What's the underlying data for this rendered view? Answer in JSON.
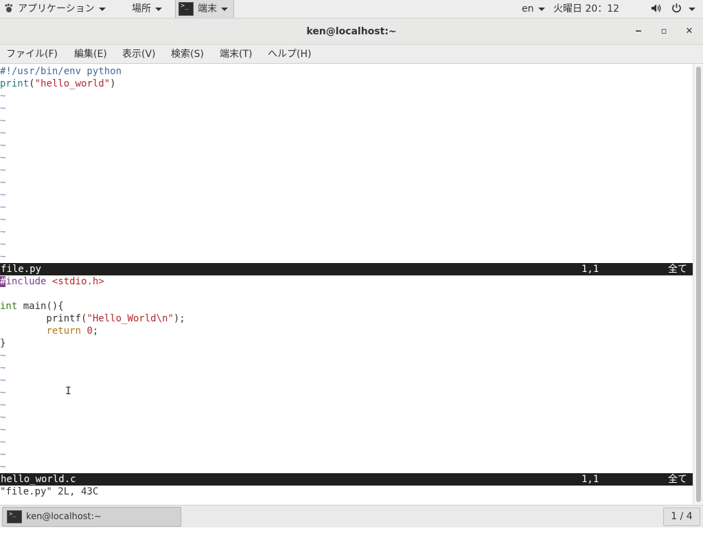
{
  "topbar": {
    "applications": "アプリケーション",
    "places": "場所",
    "active_app": "端末",
    "active_app_icon_text": ">_",
    "language": "en",
    "clock": "火曜日 20：12",
    "icons": [
      "foot-logo-icon",
      "volume-icon",
      "power-icon",
      "chevron-down-icon"
    ]
  },
  "window": {
    "title": "ken@localhost:~",
    "minimize": "‒",
    "maximize": "▫",
    "close": "✕"
  },
  "menubar": {
    "items": [
      "ファイル(F)",
      "編集(E)",
      "表示(V)",
      "検索(S)",
      "端末(T)",
      "ヘルプ(H)"
    ]
  },
  "editor": {
    "pane1": {
      "lines": [
        "#!/usr/bin/env python",
        "print(\"hello_world\")"
      ],
      "tilde": "~",
      "status": {
        "filename": "file.py",
        "position": "1,1",
        "scroll": "全て"
      }
    },
    "pane2": {
      "lines": [
        "#include <stdio.h>",
        "",
        "int main(){",
        "        printf(\"Hello_World\\n\");",
        "        return 0;",
        "}"
      ],
      "tilde": "~",
      "status": {
        "filename": "hello_world.c",
        "position": "1,1",
        "scroll": "全て"
      }
    },
    "message": "\"file.py\" 2L, 43C"
  },
  "taskbar": {
    "item": "ken@localhost:~",
    "item_icon_text": ">_",
    "workspace": "1 / 4"
  },
  "colors": {
    "statusline_bg": "#1f1f1f",
    "tilde": "#6e8fb6",
    "string": "#b3262b",
    "preproc": "#7a3c8f",
    "type": "#3d7a22"
  }
}
